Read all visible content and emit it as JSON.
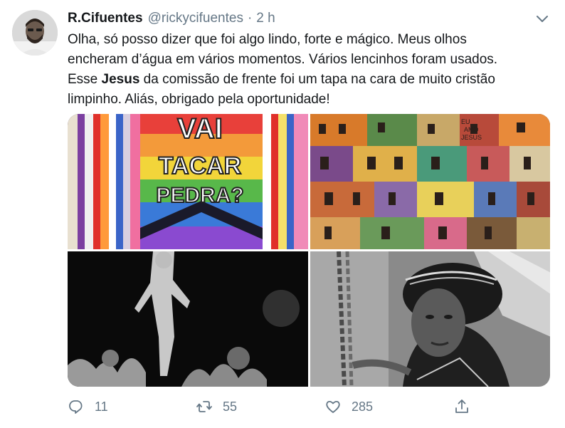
{
  "tweet": {
    "author_name": "R.Cifuentes",
    "handle": "@rickycifuentes",
    "separator": "·",
    "time": "2 h",
    "text_lines": [
      "Olha, só posso dizer que foi algo lindo, forte e mágico. Meus olhos",
      "encheram d’água em vários momentos. Vários lencinhos foram usados.",
      "Esse ",
      "Jesus",
      " da comissão de frente foi um tapa na cara de muito cristão",
      "limpinho. Aliás, obrigado pela oportunidade!"
    ],
    "media": [
      {
        "icon": "photo",
        "sign_lines": [
          "VAI",
          "TACAR",
          "PEDRA?"
        ]
      },
      {
        "icon": "photo",
        "wall_text": [
          "EU",
          "AMO",
          "JESUS"
        ]
      },
      {
        "icon": "photo"
      },
      {
        "icon": "photo"
      }
    ],
    "actions": {
      "reply_count": "11",
      "retweet_count": "55",
      "like_count": "285"
    }
  },
  "colors": {
    "text": "#14171a",
    "secondary": "#657786"
  },
  "icons": [
    "chevron-down-icon",
    "reply-icon",
    "retweet-icon",
    "like-icon",
    "share-icon"
  ]
}
